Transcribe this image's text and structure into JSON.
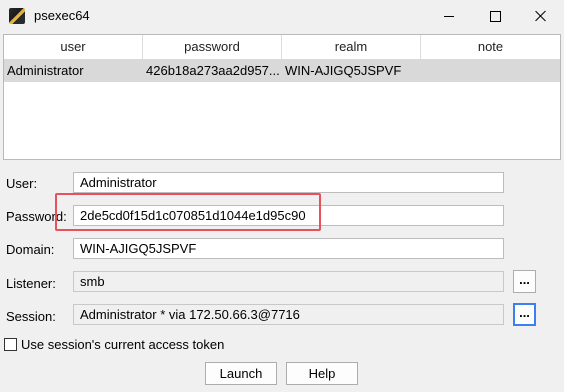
{
  "window": {
    "title": "psexec64"
  },
  "table": {
    "columns": [
      "user",
      "password",
      "realm",
      "note"
    ],
    "rows": [
      {
        "user": "Administrator",
        "password": "426b18a273aa2d957...",
        "realm": "WIN-AJIGQ5JSPVF",
        "note": ""
      }
    ]
  },
  "form": {
    "user_label": "User:",
    "user_value": "Administrator",
    "password_label": "Password:",
    "password_value": "2de5cd0f15d1c070851d1044e1d95c90",
    "domain_label": "Domain:",
    "domain_value": "WIN-AJIGQ5JSPVF",
    "listener_label": "Listener:",
    "listener_value": "smb",
    "session_label": "Session:",
    "session_value": "Administrator * via  172.50.66.3@7716",
    "browse_label": "..."
  },
  "options": {
    "use_token_label": "Use session's current access token",
    "use_token_checked": false
  },
  "buttons": {
    "launch": "Launch",
    "help": "Help"
  }
}
